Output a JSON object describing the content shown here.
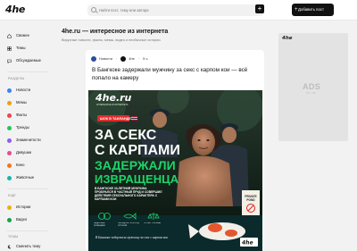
{
  "header": {
    "logo": "4he",
    "search_placeholder": "Найти пост, тему или автора",
    "add_post_label": "Добавить пост",
    "plus": "+"
  },
  "sidebar": {
    "main_items": [
      {
        "label": "Свежее",
        "icon": "house-icon"
      },
      {
        "label": "Темы",
        "icon": "grid-icon"
      },
      {
        "label": "Обсуждаемые",
        "icon": "chat-icon"
      }
    ],
    "sections_title": "РАЗДЕЛЫ",
    "section_items": [
      {
        "label": "Новости",
        "color": "#3b82f6"
      },
      {
        "label": "Мемы",
        "color": "#f59e0b"
      },
      {
        "label": "Факты",
        "color": "#ef4444"
      },
      {
        "label": "Тренды",
        "color": "#22c55e"
      },
      {
        "label": "Знаменитости",
        "color": "#8b5cf6"
      },
      {
        "label": "Девушки",
        "color": "#ec4899"
      },
      {
        "label": "Кино",
        "color": "#f97316"
      },
      {
        "label": "Животные",
        "color": "#14b8a6"
      }
    ],
    "media_title": "ЕЩЁ",
    "media_items": [
      {
        "label": "Истории",
        "color": "#eab308"
      },
      {
        "label": "Видео",
        "color": "#16a34a"
      }
    ],
    "settings_title": "ТЕМЫ",
    "settings_items": [
      {
        "label": "Сменить тему",
        "icon": "moon-icon"
      }
    ]
  },
  "feed": {
    "title": "4he.ru — интересное из интернета",
    "subtitle": "Вирусные новости, факты, мемы, видео и необычные истории."
  },
  "post": {
    "category": "Новости",
    "author": "4he",
    "time": "5 ч.",
    "title": "В Бангкоке задержали мужчину за секс с карпом кои — всё попало на камеру",
    "image": {
      "brand": "4he.ru",
      "brand_tagline": "ИНТЕРЕСНОЕ ИЗ ИНТЕРНЕТА",
      "location_badge": "ШОК В ТАИЛАНДЕ",
      "headline_1": "ЗА СЕКС",
      "headline_2": "С КАРПАМИ",
      "headline_3": "ЗАДЕРЖАЛИ",
      "headline_4": "ИЗВРАЩЕНЦА",
      "body": "В БАНГКОКЕ 33-ЛЕТНИЙ МУЖЧИНА ПРОБРАЛСЯ В ЧАСТНЫЙ ПРУД И СОВЕРШИЛ ДЕЙСТВИЯ СЕКСУАЛЬНОГО ХАРАКТЕРА С КАРПАМИ КОИ",
      "icons": [
        {
          "label": "ЗАДЕРЖАН ПОЛИЦИЕЙ",
          "icon": "handcuffs-icon"
        },
        {
          "label": "ПЯТЬДЕСЯТ КОИ ПОД УГРОЗОЙ",
          "icon": "fish-icon"
        },
        {
          "label": "ГРОЗИТ ТЮРЬМА",
          "icon": "scales-icon"
        }
      ],
      "sign": "PRIVATE POND",
      "caption": "В Бангкоке задержали мужчину за секс с карпом кои",
      "accent": "#1fd36a"
    }
  },
  "ad": {
    "logo": "4he",
    "label": "ADS",
    "small": "300 × 600"
  }
}
